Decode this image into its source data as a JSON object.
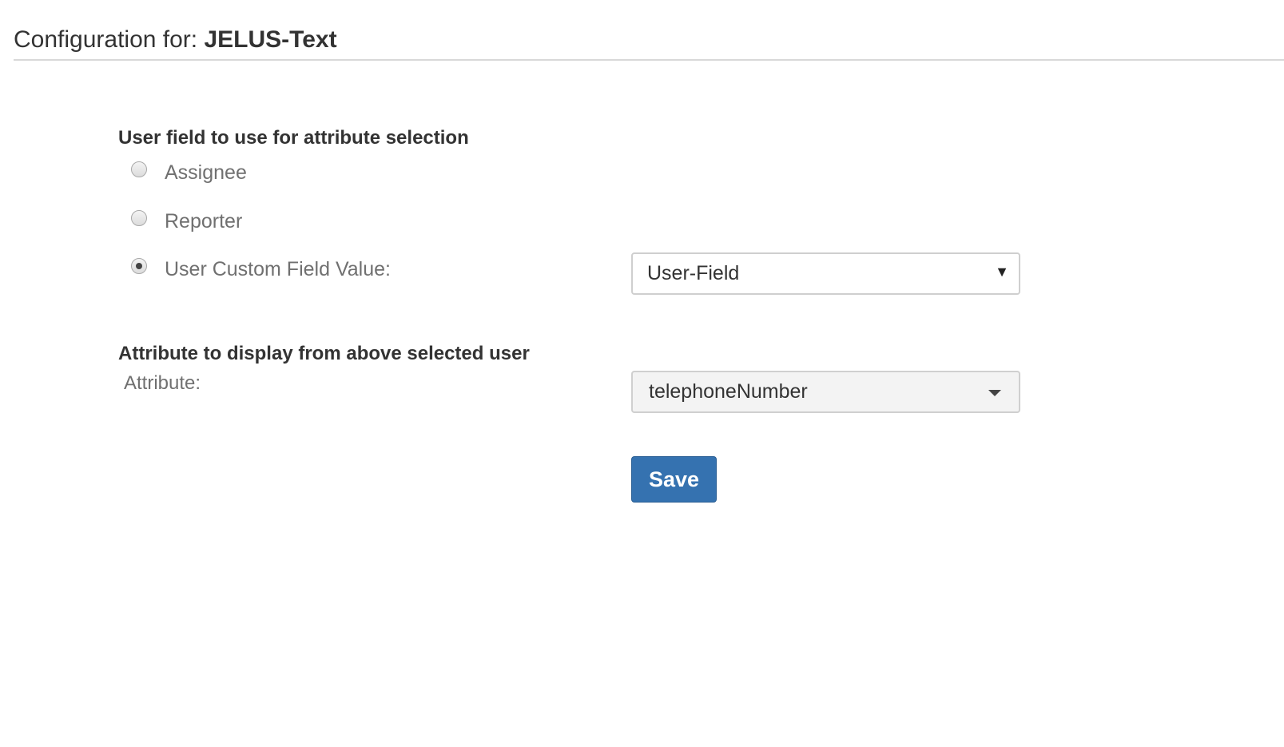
{
  "header": {
    "title_prefix": "Configuration for: ",
    "config_name": "JELUS-Text"
  },
  "user_field_section": {
    "heading": "User field to use for attribute selection",
    "options": [
      {
        "label": "Assignee",
        "checked": false
      },
      {
        "label": "Reporter",
        "checked": false
      },
      {
        "label": "User Custom Field Value:",
        "checked": true
      }
    ],
    "custom_field_select": {
      "selected": "User-Field",
      "arrow": "▼"
    }
  },
  "attribute_section": {
    "heading": "Attribute to display from above selected user",
    "label": "Attribute:",
    "attribute_select": {
      "selected": "telephoneNumber"
    }
  },
  "actions": {
    "save_label": "Save"
  },
  "colors": {
    "primary_button": "#3572b0",
    "text": "#333333",
    "muted_text": "#707070"
  }
}
